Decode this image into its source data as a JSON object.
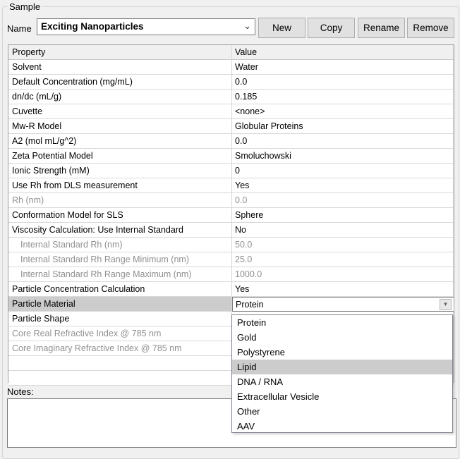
{
  "group_title": "Sample",
  "name_label": "Name",
  "sample_name": "Exciting Nanoparticles",
  "buttons": {
    "new": "New",
    "copy": "Copy",
    "rename": "Rename",
    "remove": "Remove"
  },
  "grid": {
    "header": {
      "property": "Property",
      "value": "Value"
    },
    "rows": [
      {
        "property": "Solvent",
        "value": "Water"
      },
      {
        "property": "Default Concentration (mg/mL)",
        "value": "0.0"
      },
      {
        "property": "dn/dc (mL/g)",
        "value": "0.185"
      },
      {
        "property": "Cuvette",
        "value": "<none>"
      },
      {
        "property": "Mw-R Model",
        "value": "Globular Proteins"
      },
      {
        "property": "A2 (mol mL/g^2)",
        "value": "0.0"
      },
      {
        "property": "Zeta Potential Model",
        "value": "Smoluchowski"
      },
      {
        "property": "Ionic Strength (mM)",
        "value": "0"
      },
      {
        "property": "Use Rh from DLS measurement",
        "value": "Yes"
      },
      {
        "property": "Rh (nm)",
        "value": "0.0",
        "disabled": true
      },
      {
        "property": "Conformation Model for SLS",
        "value": "Sphere"
      },
      {
        "property": "Viscosity Calculation: Use Internal Standard",
        "value": "No"
      },
      {
        "property": "Internal Standard Rh (nm)",
        "value": "50.0",
        "disabled": true,
        "indented": true
      },
      {
        "property": "Internal Standard Rh Range Minimum (nm)",
        "value": "25.0",
        "disabled": true,
        "indented": true
      },
      {
        "property": "Internal Standard Rh Range Maximum (nm)",
        "value": "1000.0",
        "disabled": true,
        "indented": true
      },
      {
        "property": "Particle Concentration Calculation",
        "value": "Yes"
      },
      {
        "property": "Particle Material",
        "value": "Protein",
        "selected": true
      },
      {
        "property": "Particle Shape",
        "value": ""
      },
      {
        "property": "Core Real Refractive Index @ 785 nm",
        "value": "",
        "disabled": true
      },
      {
        "property": "Core Imaginary Refractive Index @ 785 nm",
        "value": "",
        "disabled": true
      }
    ]
  },
  "dropdown_options": [
    "Protein",
    "Gold",
    "Polystyrene",
    "Lipid",
    "DNA / RNA",
    "Extracellular Vesicle",
    "Other",
    "AAV"
  ],
  "dropdown_highlighted": "Lipid",
  "notes_label": "Notes:",
  "notes_value": "",
  "colors": {
    "selection": "#cccccc",
    "window_bg": "#f0f0f0",
    "disabled_text": "#909090"
  }
}
